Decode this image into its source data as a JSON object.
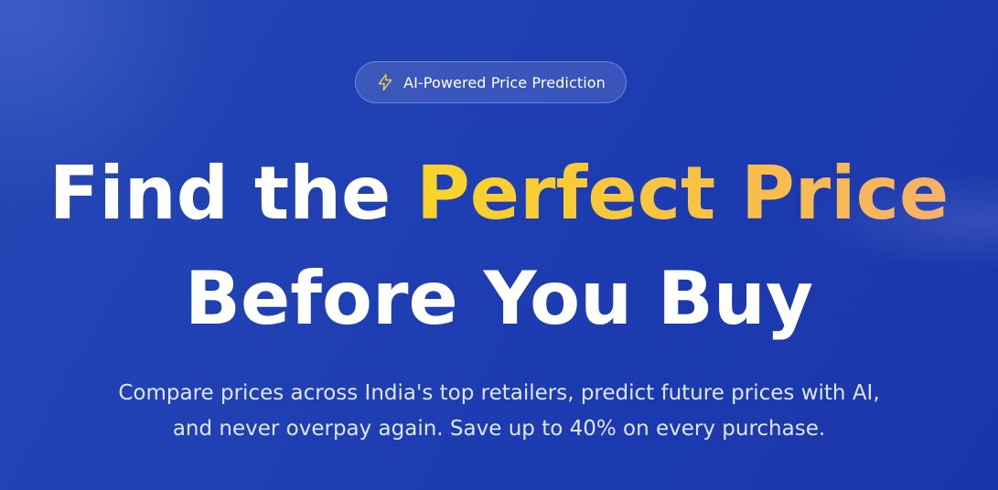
{
  "badge": {
    "icon": "lightning-bolt-icon",
    "label": "AI-Powered Price Prediction"
  },
  "headline": {
    "line1_start": "Find the ",
    "line1_highlight": "Perfect Price",
    "line2": "Before You Buy"
  },
  "subtitle": {
    "line1": "Compare prices across India's top retailers, predict future prices with AI,",
    "line2": "and never overpay again. Save up to 40% on every purchase."
  },
  "colors": {
    "background": "#1f3fb3",
    "highlight_start": "#f8d52a",
    "highlight_end": "#f6b168",
    "bolt": "#e8c84a"
  }
}
